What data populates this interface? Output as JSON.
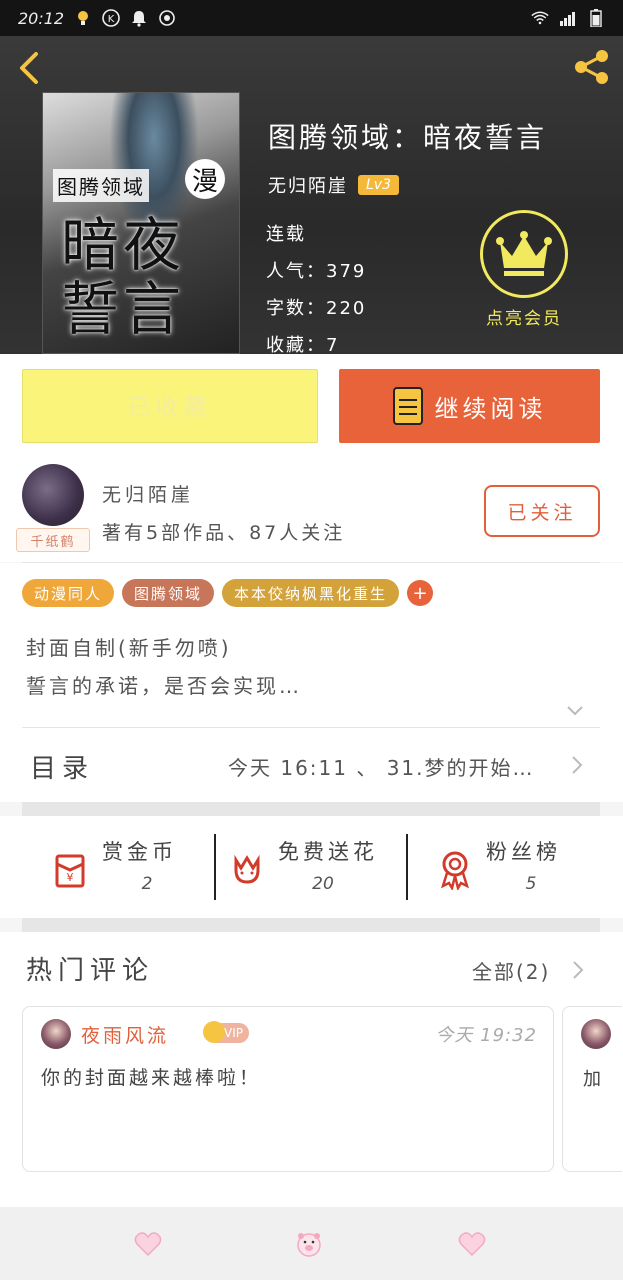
{
  "status_bar": {
    "time": "20:12",
    "icons": [
      "bulb-icon",
      "k-icon",
      "bell-icon",
      "target-icon",
      "wifi-icon",
      "signal-icon",
      "battery-icon"
    ]
  },
  "header": {
    "book_title": "图腾领域：暗夜誓言",
    "author": "无归陌崖",
    "level": "Lv3",
    "meta": {
      "status": "连载",
      "popularity": "人气：379",
      "word_count": "字数：220",
      "favorites": "收藏：7"
    },
    "vip_label": "点亮会员",
    "cover": {
      "small_title": "图腾领域",
      "big_text": "暗夜\n誓言",
      "stamp": "漫"
    }
  },
  "actions": {
    "favorite_label": "已收藏",
    "continue_label": "继续阅读"
  },
  "author_section": {
    "name": "无归陌崖",
    "stats": "著有5部作品、87人关注",
    "tag": "千纸鹤",
    "follow_label": "已关注"
  },
  "tags": [
    {
      "label": "动漫同人",
      "color": "#efa73a"
    },
    {
      "label": "图腾领域",
      "color": "#c7765a"
    },
    {
      "label": "本本佼纳枫黑化重生",
      "color": "#d4a23a"
    }
  ],
  "description": {
    "line1": "封面自制(新手勿喷)",
    "line2": "誓言的承诺，是否会实现…"
  },
  "catalog": {
    "label": "目录",
    "latest": "今天 16:11 、 31.梦的开始…"
  },
  "stats": [
    {
      "label": "赏金币",
      "value": "2"
    },
    {
      "label": "免费送花",
      "value": "20"
    },
    {
      "label": "粉丝榜",
      "value": "5"
    }
  ],
  "comments": {
    "title": "热门评论",
    "all_label": "全部(2)",
    "items": [
      {
        "name": "夜雨风流",
        "vip": "VIP",
        "time": "今天 19:32",
        "text": "你的封面越来越棒啦！"
      },
      {
        "text": "加"
      }
    ]
  },
  "colors": {
    "accent_orange": "#e8623a",
    "fav_yellow": "#fbf47a",
    "vip_yellow": "#f2ea5e",
    "header_dark": "#2f2f2f"
  }
}
